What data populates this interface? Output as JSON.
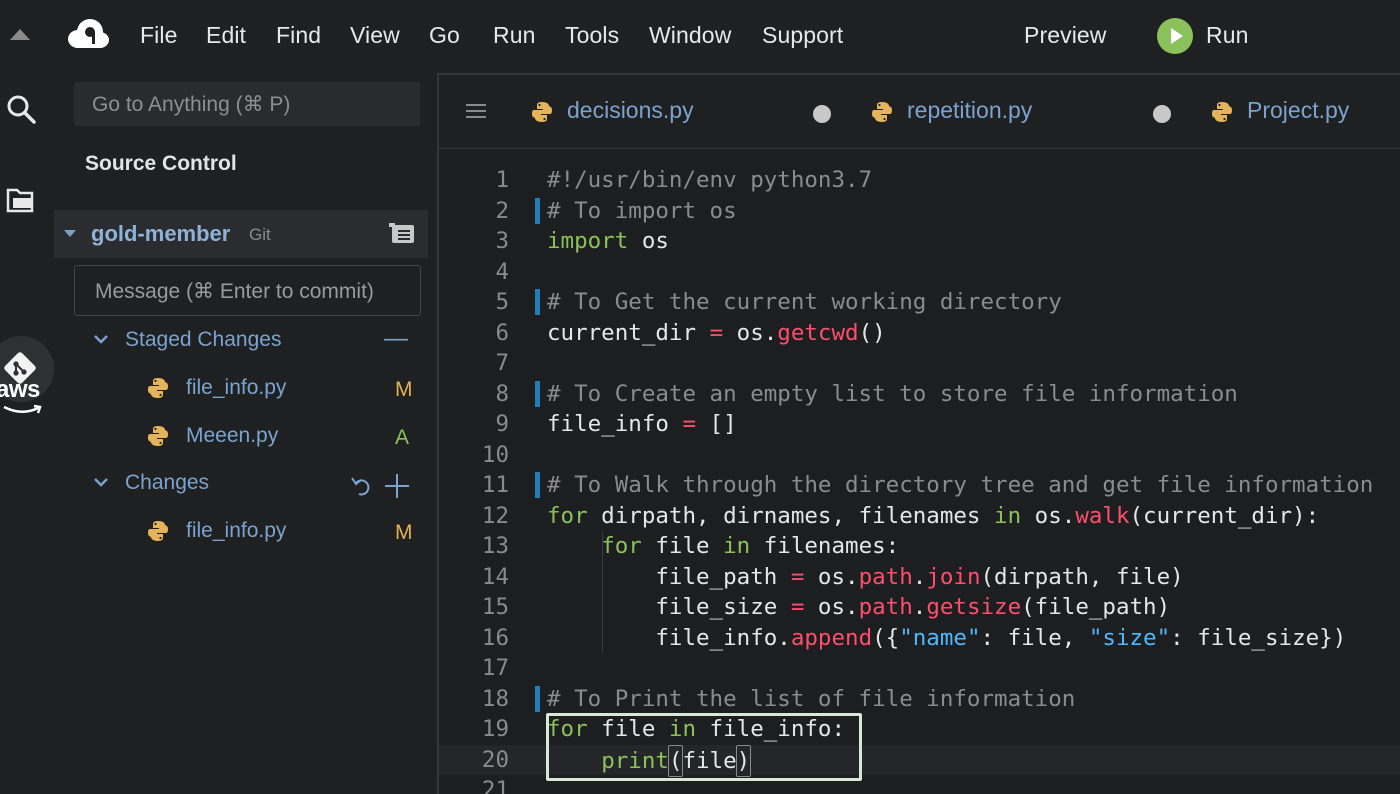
{
  "menubar": {
    "items": [
      "File",
      "Edit",
      "Find",
      "View",
      "Go",
      "Run",
      "Tools",
      "Window",
      "Support"
    ],
    "preview_label": "Preview",
    "run_label": "Run"
  },
  "rail": {
    "icons": [
      "search-icon",
      "files-icon",
      "git-icon",
      "aws-icon"
    ],
    "aws_label": "aws"
  },
  "sidebar": {
    "goto_placeholder": "Go to Anything (⌘ P)",
    "title": "Source Control",
    "repo": {
      "name": "gold-member",
      "vcs": "Git"
    },
    "message_placeholder": "Message (⌘ Enter to commit)",
    "staged": {
      "label": "Staged Changes",
      "action": "—",
      "files": [
        {
          "name": "file_info.py",
          "status": "M"
        },
        {
          "name": "Meeen.py",
          "status": "A"
        }
      ]
    },
    "changes": {
      "label": "Changes",
      "files": [
        {
          "name": "file_info.py",
          "status": "M"
        }
      ]
    }
  },
  "editor": {
    "tabs": [
      {
        "label": "decisions.py",
        "modified": true
      },
      {
        "label": "repetition.py",
        "modified": true
      },
      {
        "label": "Project.py",
        "modified": false
      }
    ],
    "line_numbers": [
      "1",
      "2",
      "3",
      "4",
      "5",
      "6",
      "7",
      "8",
      "9",
      "10",
      "11",
      "12",
      "13",
      "14",
      "15",
      "16",
      "17",
      "18",
      "19",
      "20",
      "21"
    ],
    "lines": [
      "#!/usr/bin/env python3.7",
      "# To import os",
      "import os",
      "",
      "# To Get the current working directory",
      "current_dir = os.getcwd()",
      "",
      "# To Create an empty list to store file information",
      "file_info = []",
      "",
      "# To Walk through the directory tree and get file information",
      "for dirpath, dirnames, filenames in os.walk(current_dir):",
      "    for file in filenames:",
      "        file_path = os.path.join(dirpath, file)",
      "        file_size = os.path.getsize(file_path)",
      "        file_info.append({\"name\": file, \"size\": file_size})",
      "",
      "# To Print the list of file information",
      "for file in file_info:",
      "    print(file)",
      ""
    ],
    "changed_lines": [
      2,
      5,
      8,
      11,
      18
    ],
    "current_line": 20
  },
  "colors": {
    "background": "#1f2022",
    "editor_background": "#1d1e20",
    "keyword": "#8bc15a",
    "function": "#ff4d6d",
    "string": "#4db8ff",
    "comment": "#8b8b8b",
    "link_blue": "#7aa3cf",
    "modified": "#e2b14d",
    "added": "#8bc15a",
    "run_green": "#8bc15a"
  }
}
